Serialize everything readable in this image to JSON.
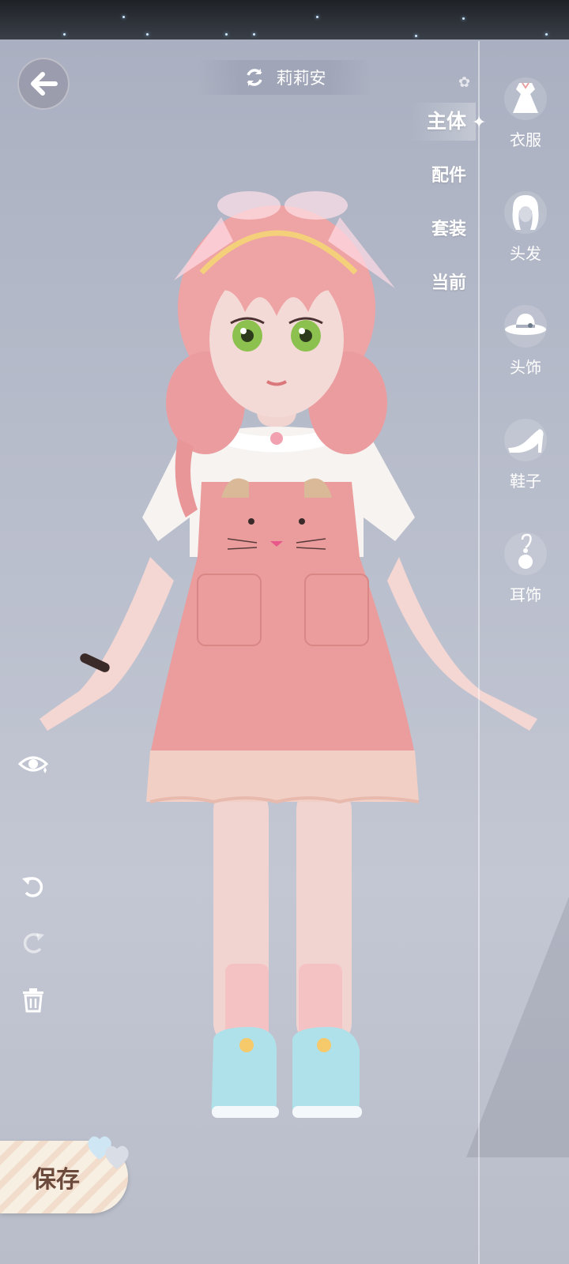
{
  "header": {
    "character_name": "莉莉安"
  },
  "sub_tabs": [
    {
      "label": "主体",
      "active": true
    },
    {
      "label": "配件",
      "active": false
    },
    {
      "label": "套装",
      "active": false
    },
    {
      "label": "当前",
      "active": false
    }
  ],
  "categories": [
    {
      "label": "衣服",
      "icon": "dress-icon"
    },
    {
      "label": "头发",
      "icon": "hair-icon"
    },
    {
      "label": "头饰",
      "icon": "hat-icon"
    },
    {
      "label": "鞋子",
      "icon": "high-heel-icon"
    },
    {
      "label": "耳饰",
      "icon": "earring-icon"
    }
  ],
  "tools": {
    "visibility": "eye-icon",
    "undo": "undo-icon",
    "redo": "redo-icon",
    "delete": "trash-icon"
  },
  "save_button": {
    "label": "保存"
  },
  "colors": {
    "accent_pink": "#e99a9a",
    "background": "#b7bccb",
    "save_text": "#6b4a3b"
  }
}
